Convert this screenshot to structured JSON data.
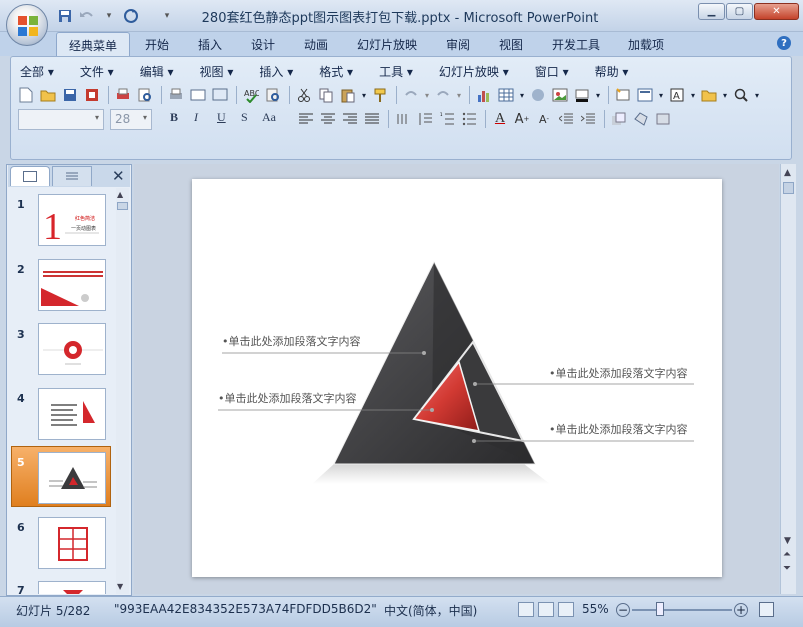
{
  "window": {
    "title": "280套红色静态ppt图示图表打包下载.pptx - Microsoft PowerPoint"
  },
  "tabs": [
    {
      "label": "经典菜单"
    },
    {
      "label": "开始"
    },
    {
      "label": "插入"
    },
    {
      "label": "设计"
    },
    {
      "label": "动画"
    },
    {
      "label": "幻灯片放映"
    },
    {
      "label": "审阅"
    },
    {
      "label": "视图"
    },
    {
      "label": "开发工具"
    },
    {
      "label": "加载项"
    }
  ],
  "menu": [
    {
      "label": "全部 ▾"
    },
    {
      "label": "文件 ▾"
    },
    {
      "label": "编辑 ▾"
    },
    {
      "label": "视图 ▾"
    },
    {
      "label": "插入 ▾"
    },
    {
      "label": "格式 ▾"
    },
    {
      "label": "工具 ▾"
    },
    {
      "label": "幻灯片放映 ▾"
    },
    {
      "label": "窗口 ▾"
    },
    {
      "label": "帮助 ▾"
    }
  ],
  "font_size": "28",
  "thumbnails": [
    {
      "num": "1",
      "line1": "红色简洁",
      "line2": "一页动图表"
    },
    {
      "num": "2"
    },
    {
      "num": "3"
    },
    {
      "num": "4"
    },
    {
      "num": "5"
    },
    {
      "num": "6"
    },
    {
      "num": "7"
    }
  ],
  "slide": {
    "bullets": [
      "•单击此处添加段落文字内容",
      "•单击此处添加段落文字内容",
      "•单击此处添加段落文字内容",
      "•单击此处添加段落文字内容"
    ]
  },
  "status": {
    "slide": "幻灯片 5/282",
    "theme": "\"993EAA42E834352E573A74FDFDD5B6D2\"",
    "language": "中文(简体，中国)",
    "zoom": "55%"
  },
  "colors": {
    "accent": "#d23a33",
    "triangle_dark": "#3b3b3d",
    "selected_thumb": "#e8902f"
  },
  "icons": [
    "office-button-icon",
    "save-icon",
    "undo-icon",
    "redo-icon",
    "help-icon",
    "close-icon"
  ]
}
